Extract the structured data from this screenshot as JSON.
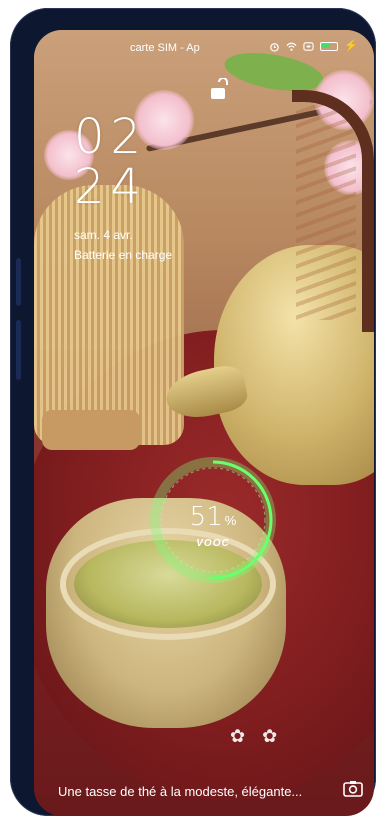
{
  "status_bar": {
    "carrier": "carte SIM - Ap",
    "icons": [
      "alarm-icon",
      "wifi-icon",
      "signal-icon",
      "battery-icon",
      "charging-bolt-icon"
    ]
  },
  "lock": {
    "icon": "unlock-icon"
  },
  "clock": {
    "hours": "02",
    "minutes": "24"
  },
  "date": "sam. 4 avr.",
  "charging_status": "Batterie en charge",
  "battery": {
    "percent": "51",
    "percent_sign": "%",
    "charging_mode": "VOOC",
    "level": 0.51
  },
  "caption": "Une tasse de thé à la modeste, élégante...",
  "colors": {
    "ring": "#6cff6c",
    "accent_green": "#4cd964",
    "text": "#ffffff"
  }
}
